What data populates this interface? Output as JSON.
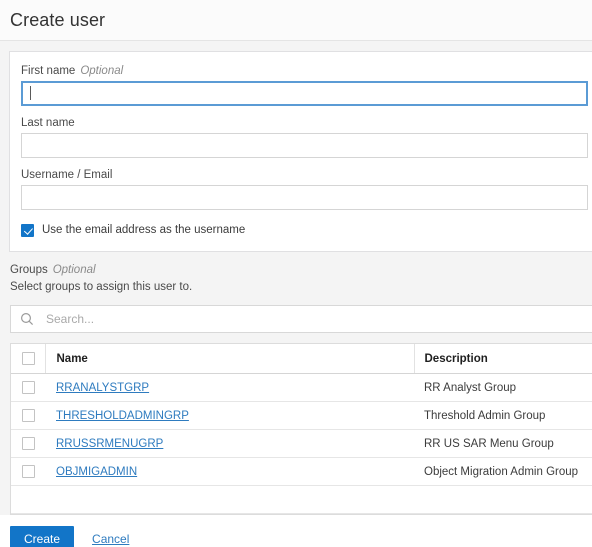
{
  "header": {
    "title": "Create user"
  },
  "form": {
    "fields": [
      {
        "label": "First name",
        "optional": "Optional",
        "value": "",
        "placeholder": "",
        "focused": true
      },
      {
        "label": "Last name",
        "optional": "",
        "value": "",
        "placeholder": "",
        "focused": false
      },
      {
        "label": "Username / Email",
        "optional": "",
        "value": "",
        "placeholder": "",
        "focused": false
      }
    ],
    "email_as_username": {
      "label": "Use the email address as the username",
      "checked": true
    }
  },
  "groups": {
    "title": "Groups",
    "optional": "Optional",
    "subtitle": "Select groups to assign this user to.",
    "search": {
      "placeholder": "Search...",
      "value": "",
      "icon": "search-icon"
    },
    "table": {
      "select_all_checked": false,
      "columns": [
        "Name",
        "Description"
      ],
      "rows": [
        {
          "name": "RRANALYSTGRP",
          "description": "RR Analyst Group",
          "checked": false
        },
        {
          "name": "THRESHOLDADMINGRP",
          "description": "Threshold Admin Group",
          "checked": false
        },
        {
          "name": "RRUSSRMENUGRP",
          "description": "RR US SAR Menu Group",
          "checked": false
        },
        {
          "name": "OBJMIGADMIN",
          "description": "Object Migration Admin Group",
          "checked": false
        }
      ]
    }
  },
  "footer": {
    "create_label": "Create",
    "cancel_label": "Cancel"
  },
  "colors": {
    "accent": "#1275c8",
    "link": "#2e7bbf",
    "focus_border": "#5b9bd5",
    "panel_bg": "#f4f4f4",
    "header_bg": "#fbfbfb"
  }
}
